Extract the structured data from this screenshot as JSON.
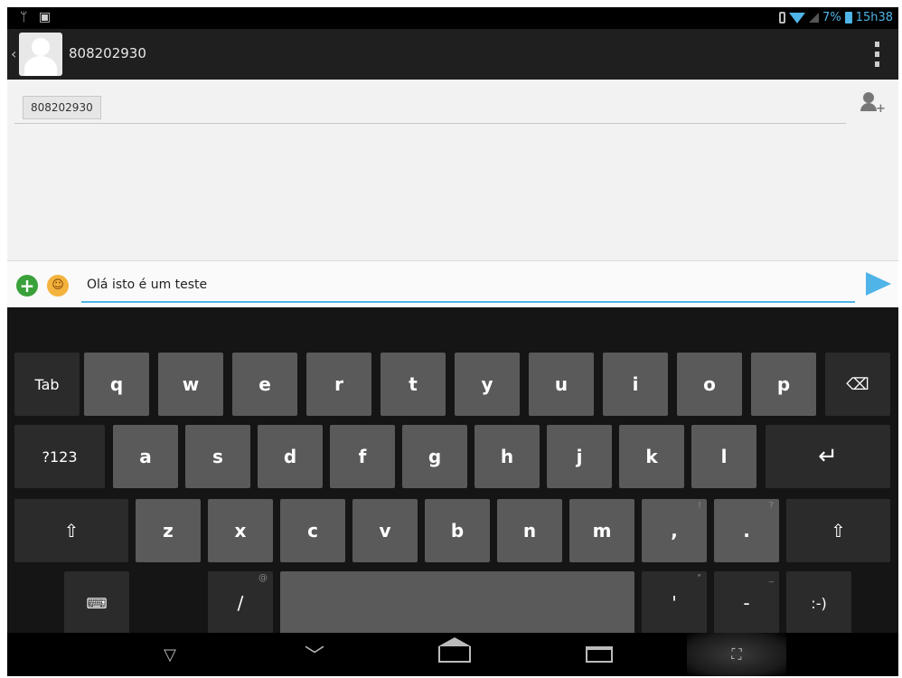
{
  "status_bar": {
    "left_icons": [
      "usb-debug-icon",
      "image-notification-icon"
    ],
    "battery_percent": "7%",
    "time": "15h38"
  },
  "action_bar": {
    "title": "808202930",
    "back_icon": "chevron-left-icon",
    "menu_icon": "overflow-menu-icon"
  },
  "recipient": {
    "chip_label": "808202930",
    "add_contact_icon": "add-contact-icon"
  },
  "compose": {
    "message_value": "Olá isto é um teste",
    "attach_icon": "+",
    "emoji_icon": "☺",
    "send_icon": "send-icon"
  },
  "keyboard": {
    "row1": [
      "Tab",
      "q",
      "w",
      "e",
      "r",
      "t",
      "y",
      "u",
      "i",
      "o",
      "p",
      "⌫"
    ],
    "row2": [
      "?123",
      "a",
      "s",
      "d",
      "f",
      "g",
      "h",
      "j",
      "k",
      "l",
      "↵"
    ],
    "row3": [
      "⇧",
      "z",
      "x",
      "c",
      "v",
      "b",
      "n",
      "m",
      ",",
      ".",
      "⇧"
    ],
    "row3_hints": {
      "comma": "!",
      "period": "?"
    },
    "row4": [
      "⌨",
      "/",
      "",
      "'",
      "-",
      ":-)"
    ],
    "row4_hints": {
      "slash": "@",
      "quote": "\"",
      "dash": "_"
    }
  },
  "nav_bar": {
    "hide_keyboard": "▽",
    "back": "﹀",
    "screenshot": "⛶"
  },
  "colors": {
    "accent": "#4fb4e8",
    "keyboard_bg": "#151515",
    "key_bg": "#5a5a5a",
    "attach_green": "#3aa13a",
    "emoji_yellow": "#f3b33d"
  }
}
